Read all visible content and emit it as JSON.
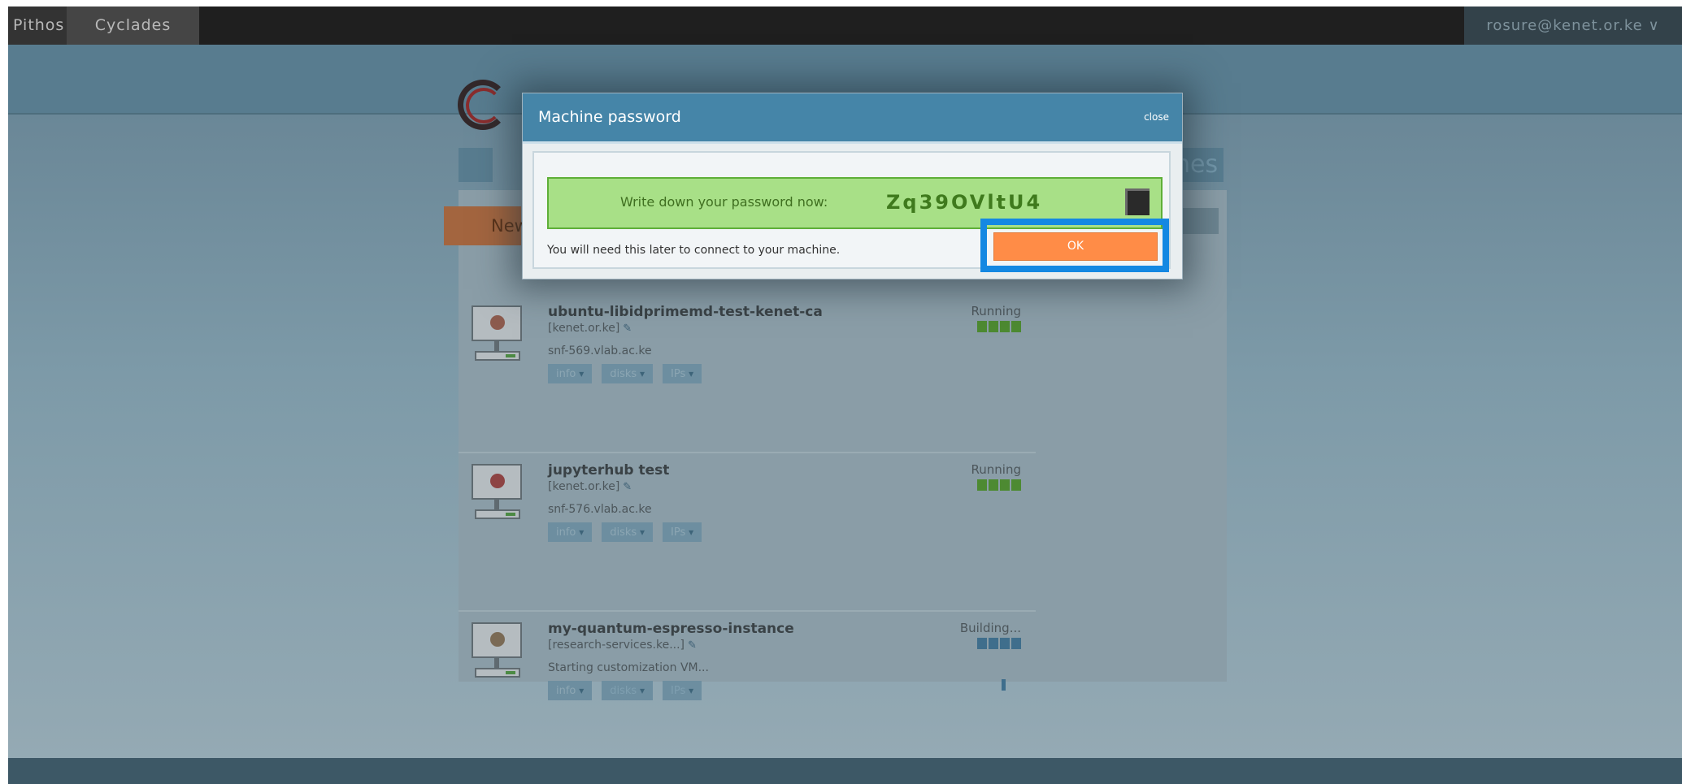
{
  "topbar": {
    "services": [
      "Pithos",
      "Cyclades"
    ],
    "user": "rosure@kenet.or.ke"
  },
  "page": {
    "new_button": "New",
    "title_fragment": "nes"
  },
  "machines": [
    {
      "name": "ubuntu-libidprimemd-test-kenet-ca",
      "project": "[kenet.or.ke]",
      "detail": "snf-569.vlab.ac.ke",
      "status": "Running",
      "actions": [
        "info",
        "disks",
        "IPs"
      ]
    },
    {
      "name": "jupyterhub test",
      "project": "[kenet.or.ke]",
      "detail": "snf-576.vlab.ac.ke",
      "status": "Running",
      "actions": [
        "info",
        "disks",
        "IPs"
      ]
    },
    {
      "name": "my-quantum-espresso-instance",
      "project": "[research-services.ke...]",
      "detail": "Starting customization VM...",
      "status": "Building...",
      "actions": [
        "info",
        "disks",
        "IPs"
      ]
    }
  ],
  "modal": {
    "title": "Machine password",
    "close_label": "close",
    "password_label": "Write down your password now:",
    "password": "Zq39OVltU4",
    "note": "You will need this later to connect to your machine.",
    "ok_label": "OK"
  },
  "colors": {
    "modal_header": "#4585a8",
    "password_box": "#a8e087",
    "ok_button": "#ff8c47",
    "focus_ring": "#1488e2",
    "running": "#4d8a32"
  }
}
